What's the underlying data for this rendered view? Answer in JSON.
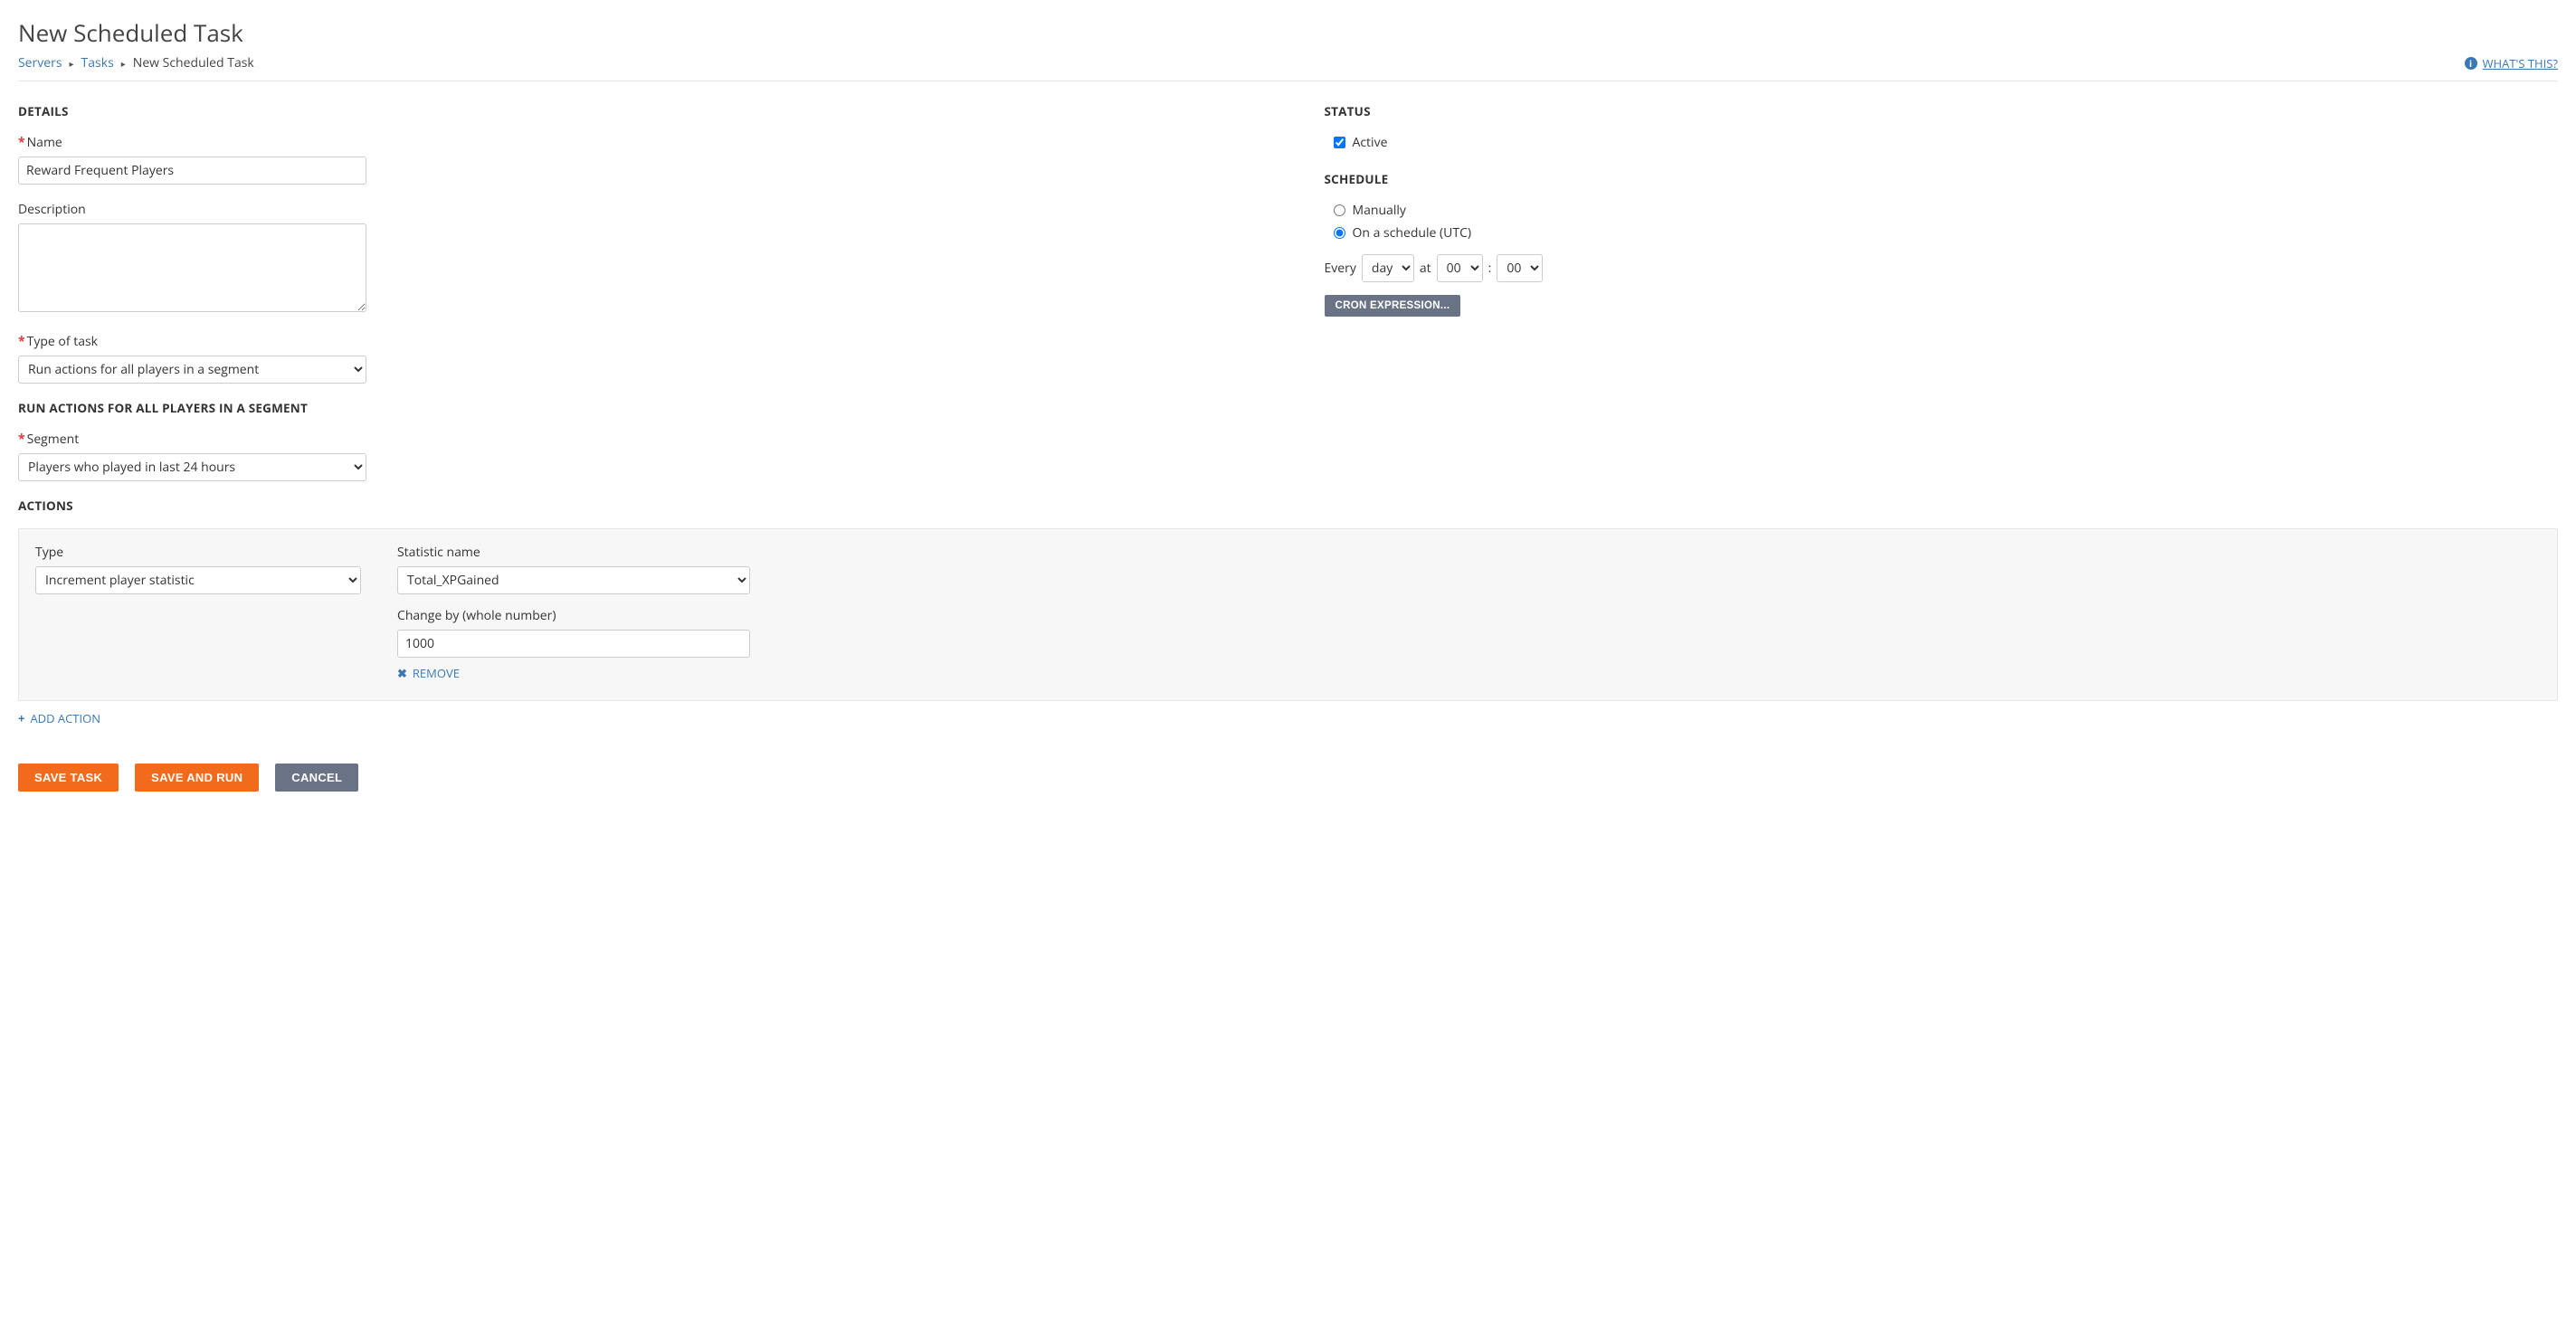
{
  "title": "New Scheduled Task",
  "breadcrumbs": {
    "items": [
      "Servers",
      "Tasks"
    ],
    "current": "New Scheduled Task"
  },
  "whats_this": "WHAT'S THIS?",
  "details": {
    "heading": "DETAILS",
    "name_label": "Name",
    "name_value": "Reward Frequent Players",
    "description_label": "Description",
    "description_value": "",
    "type_of_task_label": "Type of task",
    "type_of_task_value": "Run actions for all players in a segment"
  },
  "segment_section": {
    "heading": "RUN ACTIONS FOR ALL PLAYERS IN A SEGMENT",
    "segment_label": "Segment",
    "segment_value": "Players who played in last 24 hours"
  },
  "actions_section": {
    "heading": "ACTIONS",
    "type_label": "Type",
    "type_value": "Increment player statistic",
    "stat_label": "Statistic name",
    "stat_value": "Total_XPGained",
    "change_label": "Change by (whole number)",
    "change_value": "1000",
    "remove_label": "REMOVE",
    "add_action_label": "ADD ACTION"
  },
  "buttons": {
    "save_task": "SAVE TASK",
    "save_and_run": "SAVE AND RUN",
    "cancel": "CANCEL"
  },
  "status": {
    "heading": "STATUS",
    "active_label": "Active",
    "active_checked": true
  },
  "schedule": {
    "heading": "SCHEDULE",
    "manually_label": "Manually",
    "on_schedule_label": "On a schedule (UTC)",
    "every_label": "Every",
    "unit_value": "day",
    "at_label": "at",
    "hour_value": "00",
    "minute_value": "00",
    "cron_label": "CRON EXPRESSION..."
  }
}
